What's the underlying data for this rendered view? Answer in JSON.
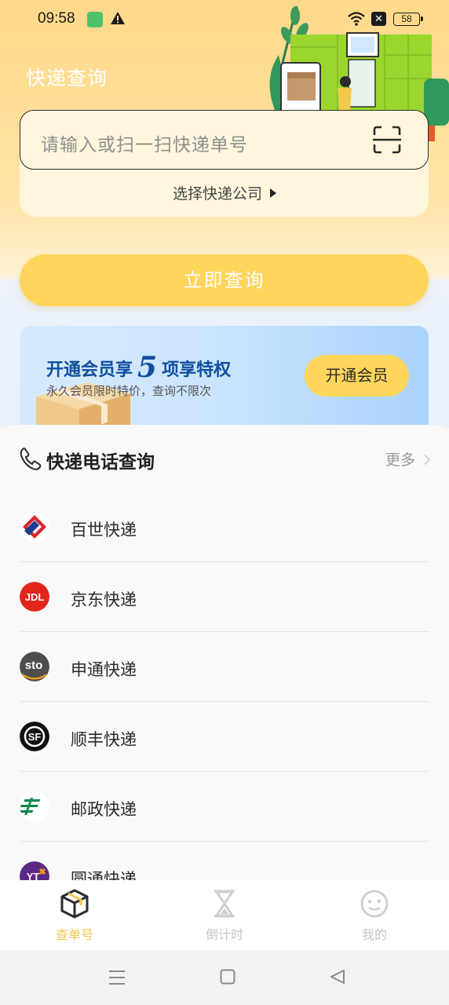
{
  "status_bar": {
    "time": "09:58",
    "battery": "58"
  },
  "header": {
    "title": "快递查询"
  },
  "search": {
    "placeholder": "请输入或扫一扫快递单号",
    "company_select": "选择快递公司",
    "query_button": "立即查询"
  },
  "vip": {
    "title_prefix": "开通会员享",
    "title_number": "5",
    "title_suffix": "项享特权",
    "subtitle": "永久会员限时特价，查询不限次",
    "button": "开通会员"
  },
  "phone_query": {
    "title": "快递电话查询",
    "more": "更多",
    "couriers": [
      {
        "name": "百世快递",
        "icon": "best-express-logo"
      },
      {
        "name": "京东快递",
        "icon": "jdl-logo"
      },
      {
        "name": "申通快递",
        "icon": "sto-logo"
      },
      {
        "name": "顺丰快递",
        "icon": "sf-logo"
      },
      {
        "name": "邮政快递",
        "icon": "china-post-logo"
      },
      {
        "name": "圆通快递",
        "icon": "yto-logo"
      }
    ]
  },
  "tabs": [
    {
      "label": "查单号",
      "icon": "package-icon",
      "active": true
    },
    {
      "label": "倒计时",
      "icon": "hourglass-icon",
      "active": false
    },
    {
      "label": "我的",
      "icon": "smiley-icon",
      "active": false
    }
  ],
  "colors": {
    "accent": "#ffd55c",
    "vip_text": "#0f4f9e",
    "active_tab": "#f3c64d"
  }
}
